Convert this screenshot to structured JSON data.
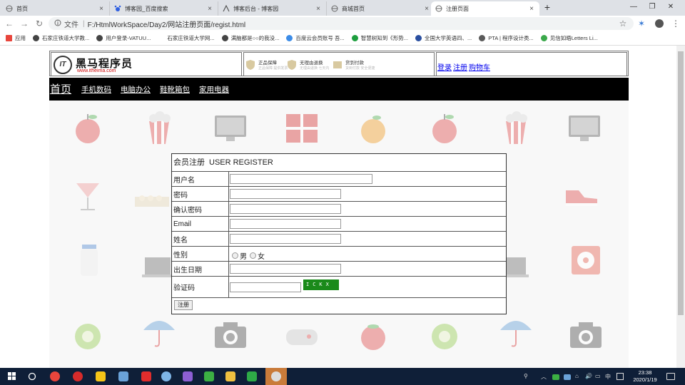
{
  "browser": {
    "tabs": [
      {
        "title": "首页",
        "icon": "globe-icon"
      },
      {
        "title": "博客园_百度搜索",
        "icon": "paw-icon"
      },
      {
        "title": "博客后台 - 博客园",
        "icon": "blog-icon"
      },
      {
        "title": "商城首页",
        "icon": "globe-icon"
      },
      {
        "title": "注册页面",
        "icon": "globe-icon",
        "active": true
      }
    ],
    "close_glyph": "×",
    "new_tab_glyph": "+",
    "address": {
      "label": "文件",
      "separator": "|",
      "url": "F:/HtmlWorkSpace/Day2/网站注册页面/regist.html"
    },
    "bookmarks": [
      {
        "label": "应用",
        "color": "#e8453c"
      },
      {
        "label": "石家庄铁道大学教...",
        "color": "#444444"
      },
      {
        "label": "用户登录-VATUU...",
        "color": "#444444"
      },
      {
        "label": "石家庄铁道大学网...",
        "color": "#ffffff"
      },
      {
        "label": "满脑都是○○的我没...",
        "color": "#444444"
      },
      {
        "label": "百度云会员账号 吾...",
        "color": "#3c8ce7"
      },
      {
        "label": "智慧树知到《形势...",
        "color": "#1d9e3e"
      },
      {
        "label": "全国大学英语四、...",
        "color": "#2a4fa0"
      },
      {
        "label": "PTA | 程序设计类...",
        "color": "#5a5a5a"
      },
      {
        "label": "见信如晤Letters Li...",
        "color": "#3aa84a"
      }
    ]
  },
  "site": {
    "logo_text": "黑马程序员",
    "logo_url": "www.itheima.com",
    "logo_mark": "IT",
    "badges": [
      {
        "label": "正品保障",
        "sub": "正品保障 提供发票"
      },
      {
        "label": "无理由退换",
        "sub": "无理由退换 七天内"
      },
      {
        "label": "货到付款",
        "sub": "货到付款 安全便捷"
      }
    ],
    "top_links": [
      "登录",
      "注册",
      "购物车"
    ],
    "nav": [
      "首页",
      "手机数码",
      "电脑办公",
      "鞋靴箱包",
      "家用电器"
    ]
  },
  "form": {
    "title": "会员注册",
    "title_en": "USER REGISTER",
    "fields": [
      {
        "label": "用户名",
        "value": ""
      },
      {
        "label": "密码",
        "value": ""
      },
      {
        "label": "确认密码",
        "value": ""
      },
      {
        "label": "Email",
        "value": ""
      },
      {
        "label": "姓名",
        "value": ""
      }
    ],
    "gender_label": "性别",
    "gender_options": [
      "男",
      "女"
    ],
    "birthday_label": "出生日期",
    "captcha_label": "验证码",
    "captcha_text": "ICKX",
    "submit_label": "注册"
  },
  "taskbar": {
    "time": "23:38",
    "date": "2020/1/19",
    "ime": "中",
    "apps": [
      {
        "name": "chrome",
        "color": "#e8453c"
      },
      {
        "name": "netease-music",
        "color": "#d62b2b"
      },
      {
        "name": "wechat-folder",
        "color": "#f5c518"
      },
      {
        "name": "network-app",
        "color": "#6aa2d9"
      },
      {
        "name": "tmall",
        "color": "#e02d2d"
      },
      {
        "name": "cloud",
        "color": "#7fb6e8"
      },
      {
        "name": "github",
        "color": "#8d5fd3"
      },
      {
        "name": "pycharm",
        "color": "#3cb043"
      },
      {
        "name": "file-explorer",
        "color": "#f0c040"
      },
      {
        "name": "hbuilder",
        "color": "#2eaa47"
      },
      {
        "name": "photo-app",
        "color": "#c97b3a"
      }
    ]
  }
}
